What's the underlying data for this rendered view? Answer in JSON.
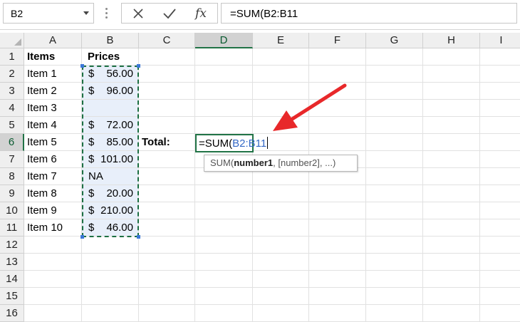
{
  "formula_bar": {
    "name_box": "B2",
    "fx_label": "fx",
    "formula": "=SUM(B2:B11"
  },
  "columns": [
    "A",
    "B",
    "C",
    "D",
    "E",
    "F",
    "G",
    "H",
    "I"
  ],
  "rows": [
    "1",
    "2",
    "3",
    "4",
    "5",
    "6",
    "7",
    "8",
    "9",
    "10",
    "11",
    "12",
    "13",
    "14",
    "15",
    "16"
  ],
  "active_column": "D",
  "active_row": "6",
  "sheet": {
    "headers": {
      "items": "Items",
      "prices": "Prices"
    },
    "items": [
      "Item 1",
      "Item 2",
      "Item 3",
      "Item 4",
      "Item 5",
      "Item 6",
      "Item 7",
      "Item 8",
      "Item 9",
      "Item 10"
    ],
    "prices": [
      {
        "cur": "$",
        "num": "56.00"
      },
      {
        "cur": "$",
        "num": "96.00"
      },
      {
        "cur": "",
        "num": ""
      },
      {
        "cur": "$",
        "num": "72.00"
      },
      {
        "cur": "$",
        "num": "85.00"
      },
      {
        "cur": "$",
        "num": "101.00"
      },
      {
        "cur": "",
        "num": "",
        "text": "NA"
      },
      {
        "cur": "$",
        "num": "20.00"
      },
      {
        "cur": "$",
        "num": "210.00"
      },
      {
        "cur": "$",
        "num": "46.00"
      }
    ],
    "total_label": "Total:"
  },
  "editing_cell": {
    "prefix": "=SUM(",
    "ref": "B2:B11"
  },
  "tooltip": {
    "fn": "SUM(",
    "arg1": "number1",
    "rest": ", [number2], ...)"
  },
  "colors": {
    "accent": "#217346",
    "reference": "#3569c6",
    "annotation_arrow": "#e8282a",
    "selection_fill": "#e8effa"
  }
}
